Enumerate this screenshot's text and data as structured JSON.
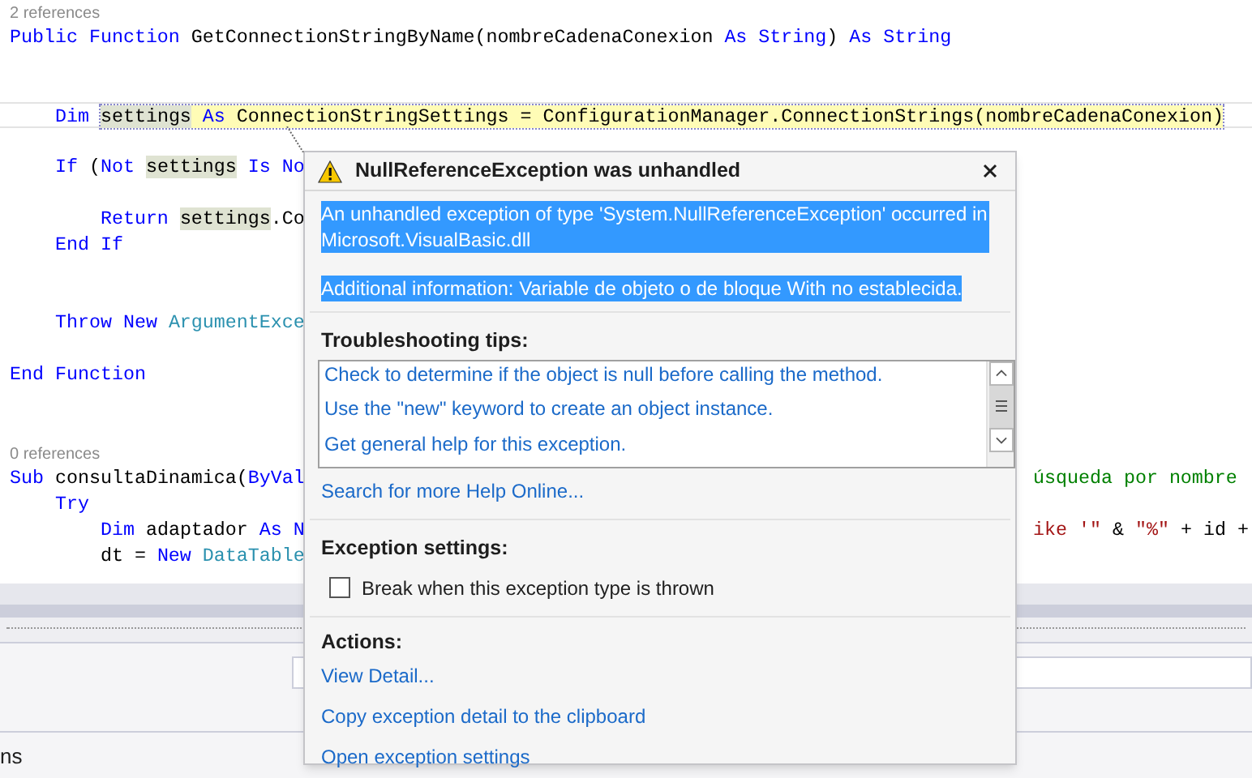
{
  "editor": {
    "lines": [
      {
        "kind": "references",
        "text": "2 references"
      },
      {
        "kind": "code",
        "current": false,
        "tokens": [
          {
            "text": "Public Function ",
            "kind": "keyword"
          },
          {
            "text": "GetConnectionStringByName(nombreCadenaConexion ",
            "kind": "plain"
          },
          {
            "text": "As String",
            "kind": "keyword"
          },
          {
            "text": ") ",
            "kind": "plain"
          },
          {
            "text": "As String",
            "kind": "keyword"
          }
        ]
      },
      {
        "kind": "blank"
      },
      {
        "kind": "blank"
      },
      {
        "kind": "code",
        "current": true,
        "tokens": [
          {
            "text": "    Dim ",
            "kind": "keyword"
          },
          {
            "text": "settings",
            "kind": "reference"
          },
          {
            "text": " As ",
            "kind": "keyword"
          },
          {
            "text": "ConnectionStringSettings = ConfigurationManager.ConnectionStrings(nombreCadenaConexion)",
            "kind": "plain"
          }
        ]
      },
      {
        "kind": "blank"
      },
      {
        "kind": "code",
        "current": false,
        "tokens": [
          {
            "text": "    If ",
            "kind": "keyword"
          },
          {
            "text": "(",
            "kind": "plain"
          },
          {
            "text": "Not ",
            "kind": "keyword"
          },
          {
            "text": "settings",
            "kind": "reference"
          },
          {
            "text": " Is No",
            "kind": "keyword"
          }
        ]
      },
      {
        "kind": "blank"
      },
      {
        "kind": "code",
        "current": false,
        "tokens": [
          {
            "text": "        Return ",
            "kind": "keyword"
          },
          {
            "text": "settings",
            "kind": "reference"
          },
          {
            "text": ".Co",
            "kind": "plain"
          }
        ]
      },
      {
        "kind": "code",
        "current": false,
        "tokens": [
          {
            "text": "    End If",
            "kind": "keyword"
          }
        ]
      },
      {
        "kind": "blank"
      },
      {
        "kind": "blank"
      },
      {
        "kind": "code",
        "current": false,
        "tokens": [
          {
            "text": "    Throw New ",
            "kind": "keyword"
          },
          {
            "text": "ArgumentExce",
            "kind": "type"
          }
        ]
      },
      {
        "kind": "blank"
      },
      {
        "kind": "code",
        "current": false,
        "tokens": [
          {
            "text": "End Function",
            "kind": "keyword"
          }
        ]
      },
      {
        "kind": "blank"
      },
      {
        "kind": "blank"
      },
      {
        "kind": "references",
        "text": "0 references"
      },
      {
        "kind": "code",
        "current": false,
        "tokens": [
          {
            "text": "Sub ",
            "kind": "keyword"
          },
          {
            "text": "consultaDinamica(",
            "kind": "plain"
          },
          {
            "text": "ByVal",
            "kind": "keyword"
          }
        ],
        "right_tokens": [
          {
            "text": "úsqueda por nombre",
            "kind": "comment"
          }
        ]
      },
      {
        "kind": "code",
        "current": false,
        "tokens": [
          {
            "text": "    Try",
            "kind": "keyword"
          }
        ]
      },
      {
        "kind": "code",
        "current": false,
        "tokens": [
          {
            "text": "        Dim ",
            "kind": "keyword"
          },
          {
            "text": "adaptador ",
            "kind": "plain"
          },
          {
            "text": "As N",
            "kind": "keyword"
          }
        ],
        "right_tokens": [
          {
            "text": "ike '\"",
            "kind": "string"
          },
          {
            "text": " & ",
            "kind": "plain"
          },
          {
            "text": "\"%\"",
            "kind": "string"
          },
          {
            "text": " + id +",
            "kind": "plain"
          }
        ]
      },
      {
        "kind": "code",
        "current": false,
        "tokens": [
          {
            "text": "        dt = ",
            "kind": "plain"
          },
          {
            "text": "New ",
            "kind": "keyword"
          },
          {
            "text": "DataTable",
            "kind": "type"
          }
        ]
      }
    ]
  },
  "output_panel": {
    "label": "ns"
  },
  "exception_popup": {
    "title": "NullReferenceException was unhandled",
    "message": {
      "text": "An unhandled exception of type 'System.NullReferenceException' occurred in Microsoft.VisualBasic.dll",
      "selected": true
    },
    "additional_info": {
      "text": "Additional information: Variable de objeto o de bloque With no establecida.",
      "selected": true
    },
    "tips_heading": "Troubleshooting tips:",
    "tips": [
      "Check to determine if the object is null before calling the method.",
      "Use the \"new\" keyword to create an object instance.",
      "Get general help for this exception."
    ],
    "help_link": "Search for more Help Online...",
    "settings_heading": "Exception settings:",
    "break_option": {
      "label": "Break when this exception type is thrown",
      "checked": false
    },
    "actions_heading": "Actions:",
    "actions": [
      "View Detail...",
      "Copy exception detail to the clipboard",
      "Open exception settings"
    ]
  }
}
